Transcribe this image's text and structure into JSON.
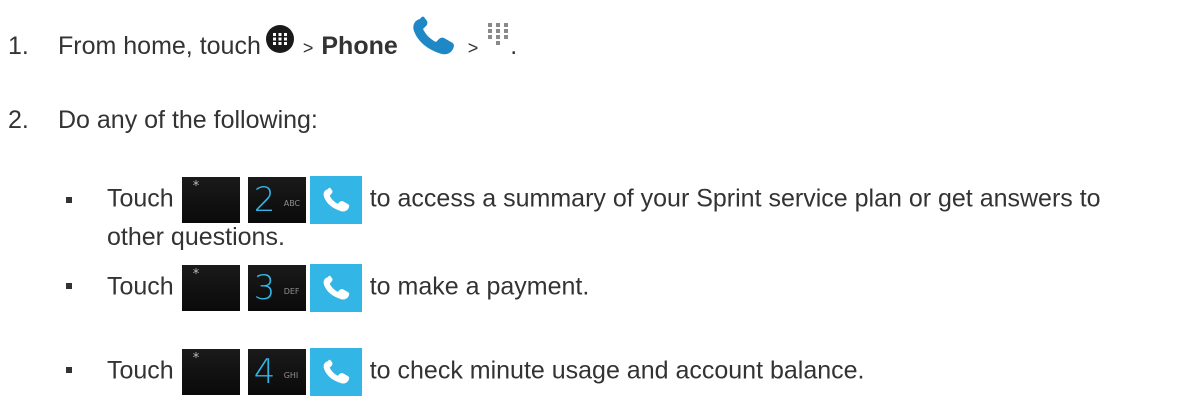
{
  "steps": [
    {
      "number": "1.",
      "text_before": "From home, touch",
      "separator": ">",
      "app_name": "Phone",
      "trailing": "."
    },
    {
      "number": "2.",
      "text": "Do any of the following:"
    }
  ],
  "bullets": [
    {
      "touch_label": "Touch",
      "key_symbol": "*",
      "digit": "2",
      "letters": "ABC",
      "description_line1": "to access a summary of your Sprint service plan or get answers to",
      "description_line2": "other questions."
    },
    {
      "touch_label": "Touch",
      "key_symbol": "*",
      "digit": "3",
      "letters": "DEF",
      "description_line1": "to make a payment."
    },
    {
      "touch_label": "Touch",
      "key_symbol": "*",
      "digit": "4",
      "letters": "GHI",
      "description_line1": "to check minute usage and account balance."
    }
  ],
  "icons": {
    "apps": "apps-icon",
    "phone": "phone-icon",
    "dialpad": "dialpad-icon",
    "call": "call-icon"
  },
  "colors": {
    "text": "#333333",
    "accent": "#33b5e5",
    "phone_icon": "#1e88c7",
    "key_background": "#111111"
  }
}
